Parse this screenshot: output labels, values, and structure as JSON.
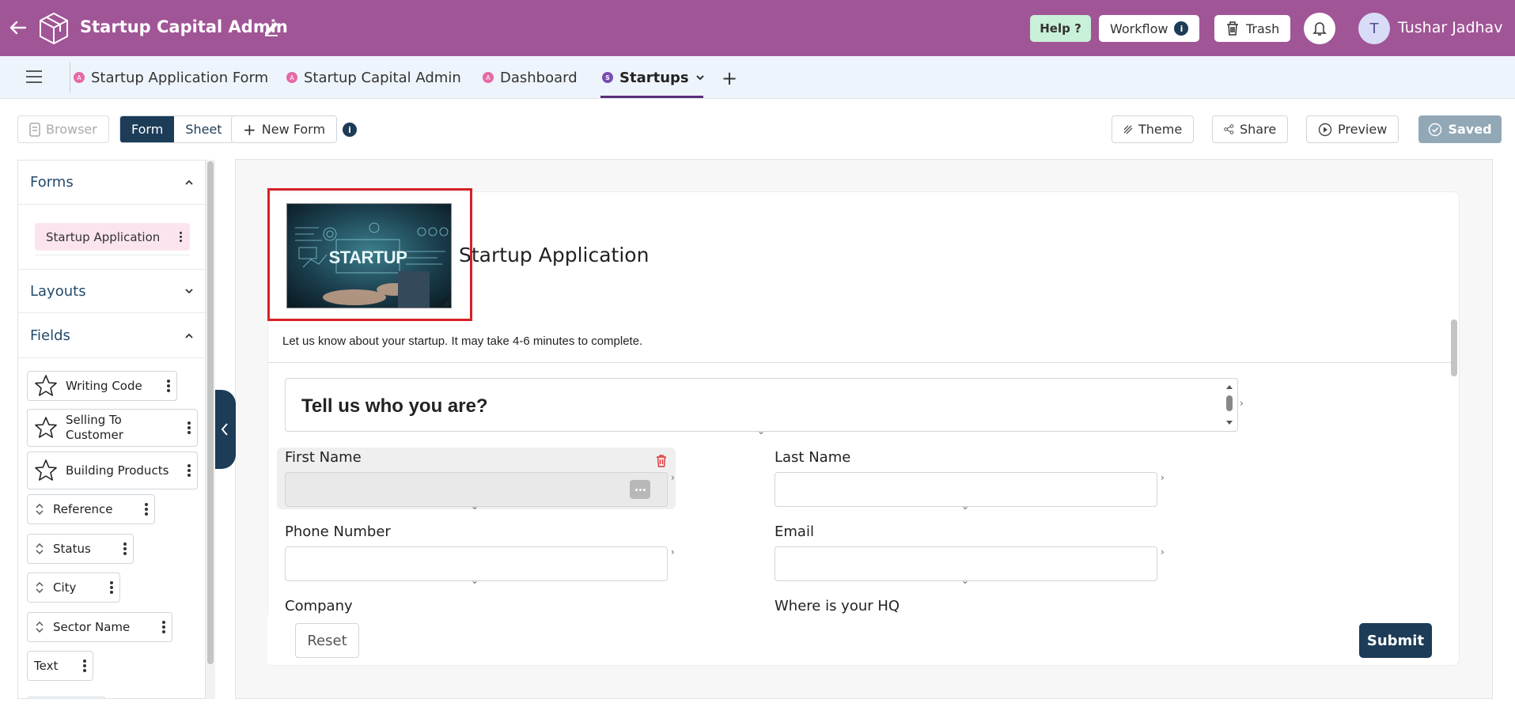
{
  "header": {
    "app_title": "Startup Capital Admin",
    "help_label": "Help ?",
    "workflow_label": "Workflow",
    "trash_label": "Trash",
    "user_initial": "T",
    "user_name": "Tushar Jadhav",
    "bg_color": "#a05596"
  },
  "tabs": [
    {
      "label": "Startup Application Form",
      "badge": "A"
    },
    {
      "label": "Startup Capital Admin",
      "badge": "A"
    },
    {
      "label": "Dashboard",
      "badge": "A"
    },
    {
      "label": "Startups",
      "badge": "S",
      "active": true
    }
  ],
  "toolbar": {
    "browser_label": "Browser",
    "form_label": "Form",
    "sheet_label": "Sheet",
    "new_form_label": "New Form",
    "theme_label": "Theme",
    "share_label": "Share",
    "preview_label": "Preview",
    "saved_label": "Saved"
  },
  "sidebar": {
    "forms_heading": "Forms",
    "form_item": "Startup Application",
    "layouts_heading": "Layouts",
    "fields_heading": "Fields",
    "fields": [
      {
        "label": "Writing Code",
        "icon": "star-icon"
      },
      {
        "label": "Selling To Customer",
        "icon": "star-icon"
      },
      {
        "label": "Building Products",
        "icon": "star-icon"
      },
      {
        "label": "Reference",
        "icon": "sort-arrows-icon"
      },
      {
        "label": "Status",
        "icon": "sort-arrows-icon"
      },
      {
        "label": "City",
        "icon": "sort-arrows-icon"
      },
      {
        "label": "Sector Name",
        "icon": "sort-arrows-icon"
      },
      {
        "label": "Text",
        "icon": "none"
      }
    ]
  },
  "form": {
    "title": "Startup Application",
    "image_text": "STARTUP",
    "description": "Let us know about your startup. It may take 4-6 minutes to complete.",
    "section_title": "Tell us who you are?",
    "first_name_label": "First Name",
    "last_name_label": "Last Name",
    "phone_label": "Phone Number",
    "email_label": "Email",
    "company_label": "Company",
    "hq_label": "Where is your HQ",
    "reset_label": "Reset",
    "submit_label": "Submit"
  }
}
